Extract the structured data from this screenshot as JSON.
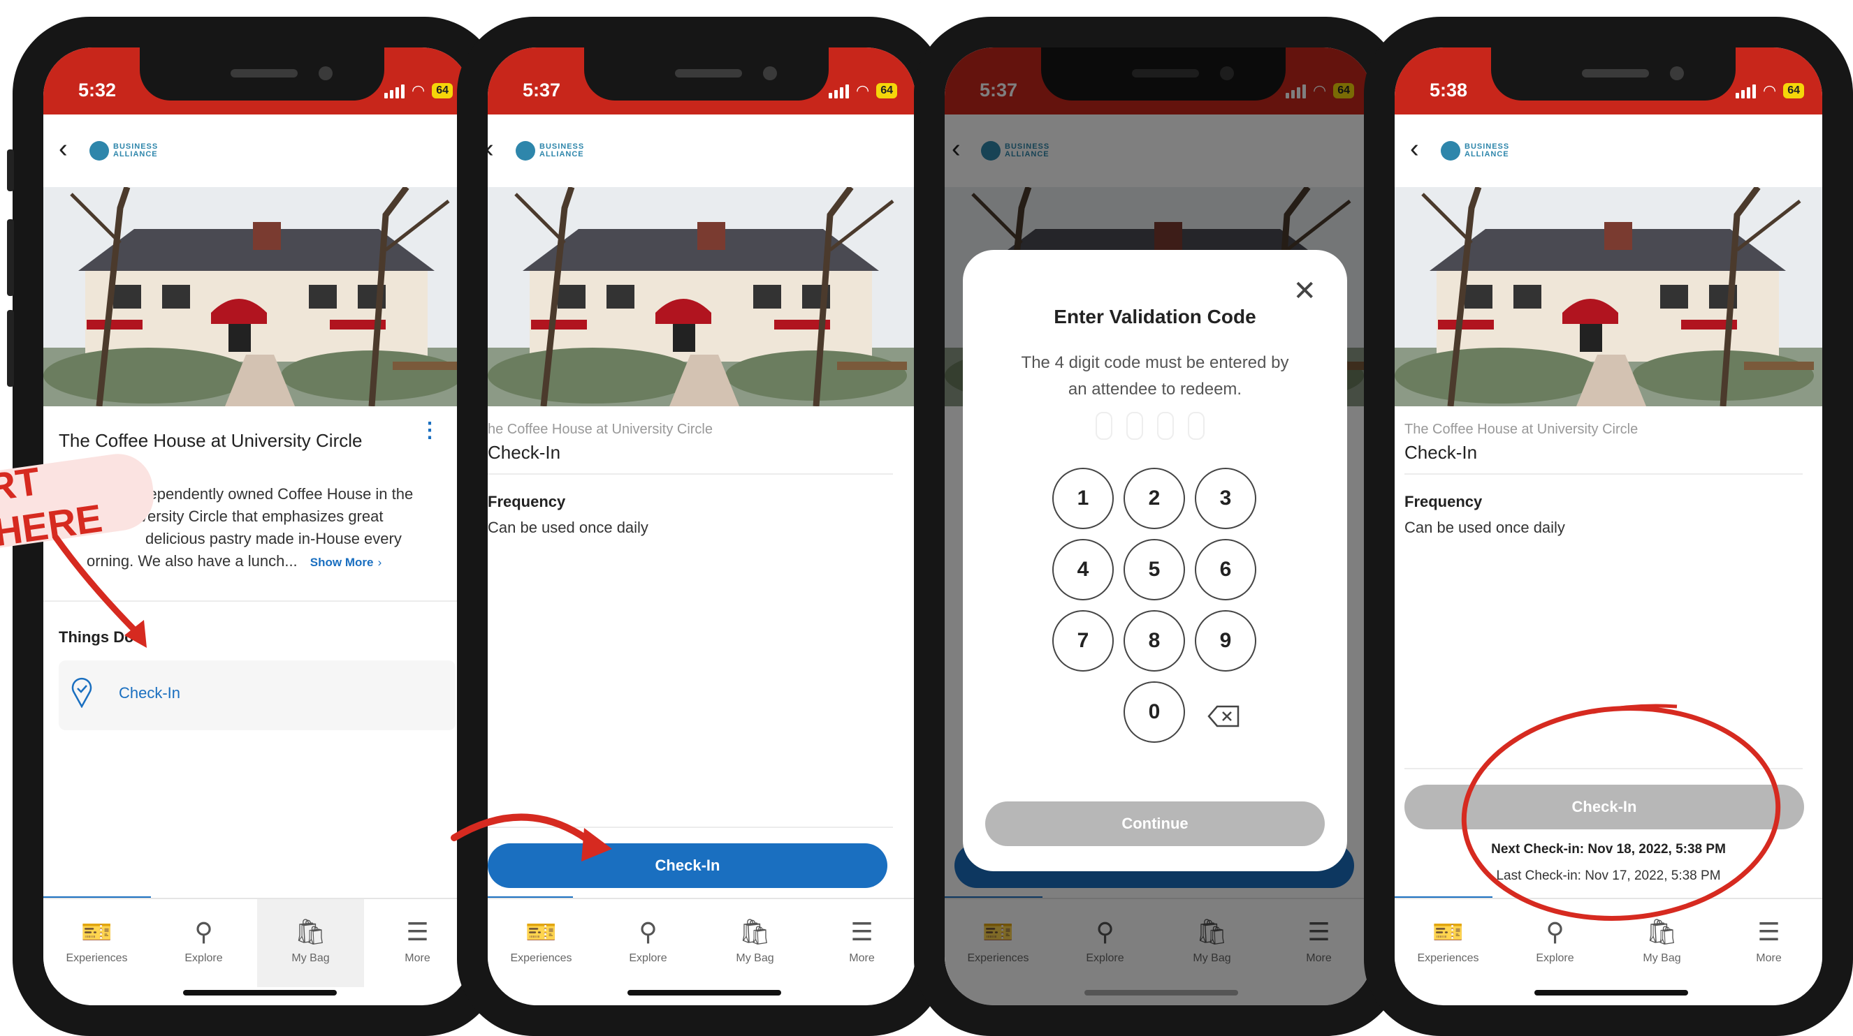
{
  "status": {
    "times": [
      "5:32",
      "5:37",
      "5:37",
      "5:38"
    ],
    "battery": "64"
  },
  "icons": {
    "back": "chevron-left-icon",
    "more": "vertical-dots-icon",
    "pin": "map-pin-check-icon",
    "close": "close-icon",
    "backspace": "backspace-icon"
  },
  "colors": {
    "status_bar": "#c8261b",
    "primary": "#1a6fc0",
    "disabled": "#b7b7b7",
    "annotation_red": "#d62a20"
  },
  "screen1": {
    "title": "The Coffee House at University Circle",
    "description_lines": [
      "ndependently owned Coffee House in the",
      "versity Circle that emphasizes great",
      "delicious pastry made in-House every",
      "orning. We also have a lunch..."
    ],
    "show_more": "Show More",
    "things_to_do": "Things  Do",
    "checkin_item": "Check-In",
    "banner": "RT HERE"
  },
  "screen2": {
    "venue": "he Coffee House at University Circle",
    "title": "Check-In",
    "frequency_label": "Frequency",
    "frequency_value": "Can be used once daily",
    "button": "Check-In"
  },
  "screen3": {
    "modal_title": "Enter Validation Code",
    "modal_text_1": "The 4 digit code must be entered by",
    "modal_text_2": "an attendee to redeem.",
    "keys": [
      "1",
      "2",
      "3",
      "4",
      "5",
      "6",
      "7",
      "8",
      "9",
      "0"
    ],
    "continue": "Continue"
  },
  "screen4": {
    "venue": "The Coffee House at University Circle",
    "title": "Check-In",
    "frequency_label": "Frequency",
    "frequency_value": "Can be used once daily",
    "button": "Check-In",
    "next_checkin": "Next Check-in: Nov 18, 2022, 5:38 PM",
    "last_checkin": "Last Check-in: Nov 17, 2022, 5:38 PM"
  },
  "tabs": [
    {
      "label": "Experiences",
      "icon": "ticket-icon"
    },
    {
      "label": "Explore",
      "icon": "compass-icon"
    },
    {
      "label": "My Bag",
      "icon": "shopping-bag-icon"
    },
    {
      "label": "More",
      "icon": "menu-icon"
    }
  ]
}
